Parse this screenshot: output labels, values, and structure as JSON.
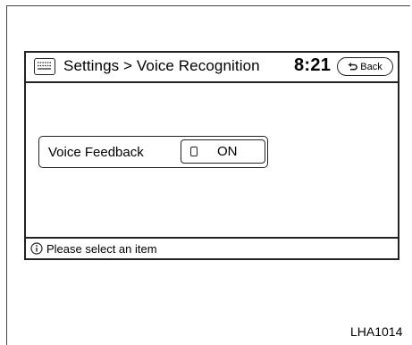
{
  "header": {
    "menu_icon": "menu-icon",
    "title": "Settings > Voice Recognition",
    "clock": "8:21",
    "back_label": "Back",
    "back_icon": "back-arrow-icon"
  },
  "main": {
    "settings": [
      {
        "label": "Voice Feedback",
        "toggle_label": "ON",
        "toggle_state": "on"
      }
    ]
  },
  "status_bar": {
    "icon": "info-icon",
    "message": "Please select an item"
  },
  "figure_code": "LHA1014"
}
